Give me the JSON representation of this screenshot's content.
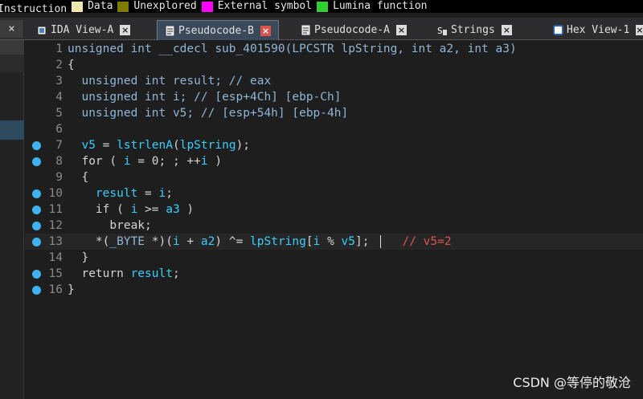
{
  "legend": [
    {
      "label": "Instruction",
      "color": null
    },
    {
      "label": "Data",
      "color": "#f0e6b0"
    },
    {
      "label": "Unexplored",
      "color": "#807a00"
    },
    {
      "label": "External symbol",
      "color": "#ff00ff"
    },
    {
      "label": "Lumina function",
      "color": "#33cc33"
    }
  ],
  "tabs": [
    {
      "label": "IDA View-A",
      "icon": "ida-view-icon",
      "close": "×",
      "active": false
    },
    {
      "label": "Pseudocode-B",
      "icon": "pseudocode-icon",
      "close": "×",
      "active": true
    },
    {
      "label": "Pseudocode-A",
      "icon": "pseudocode-icon",
      "close": "×",
      "active": false
    },
    {
      "label": "Strings",
      "icon": "strings-icon",
      "close": "×",
      "active": false
    },
    {
      "label": "Hex View-1",
      "icon": "hex-view-icon",
      "close": "×",
      "active": false
    }
  ],
  "left_close": "×",
  "code": {
    "lines": [
      {
        "n": "1",
        "bp": false,
        "html": "<span class=\"kw\">unsigned int __cdecl sub_401590(LPCSTR lpString, int a2, int a3)</span>"
      },
      {
        "n": "2",
        "bp": false,
        "html": "{"
      },
      {
        "n": "3",
        "bp": false,
        "html": "  <span class=\"kw\">unsigned int result; // eax</span>"
      },
      {
        "n": "4",
        "bp": false,
        "html": "  <span class=\"kw\">unsigned int i; // [esp+4Ch] [ebp-Ch]</span>"
      },
      {
        "n": "5",
        "bp": false,
        "html": "  <span class=\"kw\">unsigned int v5; // [esp+54h] [ebp-4h]</span>"
      },
      {
        "n": "6",
        "bp": false,
        "html": ""
      },
      {
        "n": "7",
        "bp": true,
        "html": "  <span class=\"id\">v5</span> = <span class=\"fn\">lstrlenA</span>(<span class=\"id\">lpString</span>);"
      },
      {
        "n": "8",
        "bp": true,
        "html": "  for ( <span class=\"id\">i</span> = 0; ; ++<span class=\"id\">i</span> )"
      },
      {
        "n": "9",
        "bp": false,
        "html": "  {"
      },
      {
        "n": "10",
        "bp": true,
        "html": "    <span class=\"id\">result</span> = <span class=\"id\">i</span>;"
      },
      {
        "n": "11",
        "bp": true,
        "html": "    if ( <span class=\"id\">i</span> >= <span class=\"id\">a3</span> )"
      },
      {
        "n": "12",
        "bp": true,
        "html": "      break;"
      },
      {
        "n": "13",
        "bp": true,
        "current": true,
        "html": "    *(<span class=\"kw\">_BYTE</span> *)(<span class=\"id\">i</span> + <span class=\"id\">a2</span>) ^= <span class=\"id\">lpString</span>[<span class=\"id\">i</span> % <span class=\"id\">v5</span>];<span class=\"caret\"></span><span class=\"red\">// v5=2</span>"
      },
      {
        "n": "14",
        "bp": false,
        "html": "  }"
      },
      {
        "n": "15",
        "bp": true,
        "html": "  return <span class=\"id\">result</span>;"
      },
      {
        "n": "16",
        "bp": true,
        "html": "}"
      }
    ]
  },
  "watermark": "CSDN @等停的敬沧"
}
